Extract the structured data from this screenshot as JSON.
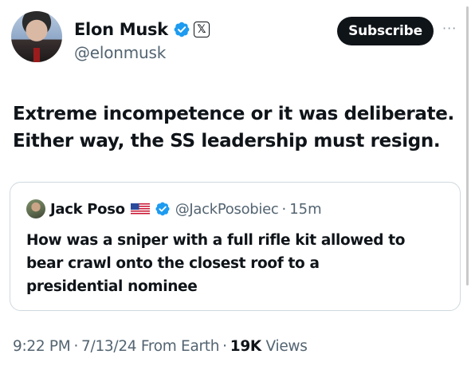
{
  "author": {
    "display_name": "Elon Musk",
    "handle": "@elonmusk",
    "verified_icon": "verified-badge-icon",
    "affiliation_icon": "x-logo-icon",
    "affiliation_glyph": "𝕏"
  },
  "actions": {
    "subscribe_label": "Subscribe",
    "more_label": "···"
  },
  "tweet": {
    "lines": [
      "Extreme incompetence or it was deliberate.",
      "Either way, the SS leadership must resign."
    ]
  },
  "quote": {
    "display_name": "Jack Poso",
    "flag_icon": "us-flag-icon",
    "verified_icon": "verified-badge-icon",
    "handle": "@JackPosobiec",
    "separator": "·",
    "time": "15m",
    "lines": [
      "How was a sniper with a full rifle kit allowed to",
      "bear crawl onto the closest roof to a",
      "presidential nominee"
    ]
  },
  "meta": {
    "time": "9:22 PM",
    "sep1": "·",
    "date": "7/13/24 From Earth",
    "sep2": "·",
    "views_count": "19K",
    "views_label": "Views"
  },
  "colors": {
    "text": "#0f1419",
    "secondary": "#536471",
    "verified_blue": "#1d9bf0",
    "border": "#cfd9de"
  }
}
